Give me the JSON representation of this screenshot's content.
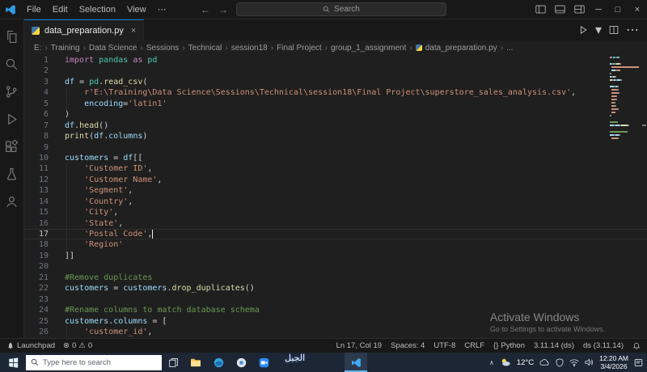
{
  "titlebar": {
    "menus": [
      "File",
      "Edit",
      "Selection",
      "View"
    ],
    "more": "⋯",
    "nav_back": "←",
    "nav_forward": "→",
    "search_placeholder": "Search",
    "window_controls": {
      "minimize": "─",
      "maximize": "□",
      "close": "×"
    }
  },
  "tab": {
    "label": "data_preparation.py",
    "close": "×"
  },
  "tab_actions": {
    "run_dropdown": "▾",
    "more": "⋯"
  },
  "breadcrumb": {
    "separator": "›",
    "file_index": 8,
    "items": [
      "E:",
      "Training",
      "Data Science",
      "Sessions",
      "Technical",
      "session18",
      "Final Project",
      "group_1_assignment",
      "data_preparation.py",
      "..."
    ]
  },
  "editor": {
    "cursor": {
      "line": 17,
      "col": 19
    },
    "lines": [
      {
        "n": 1,
        "t": [
          [
            "kw",
            "import"
          ],
          [
            "pl",
            " "
          ],
          [
            "mod",
            "pandas"
          ],
          [
            "pl",
            " "
          ],
          [
            "kw",
            "as"
          ],
          [
            "pl",
            " "
          ],
          [
            "mod",
            "pd"
          ]
        ]
      },
      {
        "n": 2,
        "t": []
      },
      {
        "n": 3,
        "t": [
          [
            "var",
            "df"
          ],
          [
            "pl",
            " = "
          ],
          [
            "mod",
            "pd"
          ],
          [
            "pl",
            "."
          ],
          [
            "fn",
            "read_csv"
          ],
          [
            "pl",
            "("
          ]
        ]
      },
      {
        "n": 4,
        "guide": true,
        "t": [
          [
            "pl",
            "    "
          ],
          [
            "str",
            "r'E:\\Training\\Data Science\\Sessions\\Technical\\session18\\Final Project\\superstore_sales_analysis.csv'"
          ],
          [
            "pl",
            ","
          ]
        ]
      },
      {
        "n": 5,
        "guide": true,
        "t": [
          [
            "pl",
            "    "
          ],
          [
            "var",
            "encoding"
          ],
          [
            "pl",
            "="
          ],
          [
            "str",
            "'latin1'"
          ]
        ]
      },
      {
        "n": 6,
        "t": [
          [
            "pl",
            ")"
          ]
        ]
      },
      {
        "n": 7,
        "t": [
          [
            "var",
            "df"
          ],
          [
            "pl",
            "."
          ],
          [
            "fn",
            "head"
          ],
          [
            "pl",
            "()"
          ]
        ]
      },
      {
        "n": 8,
        "t": [
          [
            "fn",
            "print"
          ],
          [
            "pl",
            "("
          ],
          [
            "var",
            "df"
          ],
          [
            "pl",
            "."
          ],
          [
            "var",
            "columns"
          ],
          [
            "pl",
            ")"
          ]
        ]
      },
      {
        "n": 9,
        "t": []
      },
      {
        "n": 10,
        "t": [
          [
            "var",
            "customers"
          ],
          [
            "pl",
            " = "
          ],
          [
            "var",
            "df"
          ],
          [
            "pl",
            "[["
          ]
        ]
      },
      {
        "n": 11,
        "guide": true,
        "t": [
          [
            "pl",
            "    "
          ],
          [
            "str",
            "'Customer ID'"
          ],
          [
            "pl",
            ","
          ]
        ]
      },
      {
        "n": 12,
        "guide": true,
        "t": [
          [
            "pl",
            "    "
          ],
          [
            "str",
            "'Customer Name'"
          ],
          [
            "pl",
            ","
          ]
        ]
      },
      {
        "n": 13,
        "guide": true,
        "t": [
          [
            "pl",
            "    "
          ],
          [
            "str",
            "'Segment'"
          ],
          [
            "pl",
            ","
          ]
        ]
      },
      {
        "n": 14,
        "guide": true,
        "t": [
          [
            "pl",
            "    "
          ],
          [
            "str",
            "'Country'"
          ],
          [
            "pl",
            ","
          ]
        ]
      },
      {
        "n": 15,
        "guide": true,
        "t": [
          [
            "pl",
            "    "
          ],
          [
            "str",
            "'City'"
          ],
          [
            "pl",
            ","
          ]
        ]
      },
      {
        "n": 16,
        "guide": true,
        "t": [
          [
            "pl",
            "    "
          ],
          [
            "str",
            "'State'"
          ],
          [
            "pl",
            ","
          ]
        ]
      },
      {
        "n": 17,
        "guide": true,
        "t": [
          [
            "pl",
            "    "
          ],
          [
            "str",
            "'Postal Code'"
          ],
          [
            "pl",
            ","
          ]
        ]
      },
      {
        "n": 18,
        "guide": true,
        "t": [
          [
            "pl",
            "    "
          ],
          [
            "str",
            "'Region'"
          ]
        ]
      },
      {
        "n": 19,
        "t": [
          [
            "pl",
            "]]"
          ]
        ]
      },
      {
        "n": 20,
        "t": []
      },
      {
        "n": 21,
        "t": [
          [
            "com",
            "#Remove duplicates"
          ]
        ]
      },
      {
        "n": 22,
        "t": [
          [
            "var",
            "customers"
          ],
          [
            "pl",
            " = "
          ],
          [
            "var",
            "customers"
          ],
          [
            "pl",
            "."
          ],
          [
            "fn",
            "drop_duplicates"
          ],
          [
            "pl",
            "()"
          ]
        ]
      },
      {
        "n": 23,
        "t": []
      },
      {
        "n": 24,
        "t": [
          [
            "com",
            "#Rename columns to match database schema"
          ]
        ]
      },
      {
        "n": 25,
        "t": [
          [
            "var",
            "customers"
          ],
          [
            "pl",
            "."
          ],
          [
            "var",
            "columns"
          ],
          [
            "pl",
            " = ["
          ]
        ]
      },
      {
        "n": 26,
        "guide": true,
        "t": [
          [
            "pl",
            "    "
          ],
          [
            "str",
            "'customer_id'"
          ],
          [
            "pl",
            ","
          ]
        ]
      }
    ]
  },
  "activate": {
    "line1": "Activate Windows",
    "line2": "Go to Settings to activate Windows."
  },
  "statusbar": {
    "launchpad": "Launchpad",
    "error_icon": "⊗",
    "errors": "0",
    "warning_icon": "⚠",
    "warnings": "0",
    "ln_col": "Ln 17, Col 19",
    "spaces": "Spaces: 4",
    "encoding": "UTF-8",
    "eol": "CRLF",
    "lang_icon": "{}",
    "language": "Python",
    "interpreter": "3.11.14 (ds)",
    "env": "ds (3.11.14)"
  },
  "taskbar": {
    "search_placeholder": "Type here to search",
    "tray_chevron": "∧",
    "weather": "12°C",
    "time": "12:20 AM",
    "date": "3/4/2026"
  },
  "overlay": {
    "arabic_watermark": "الجيل"
  }
}
